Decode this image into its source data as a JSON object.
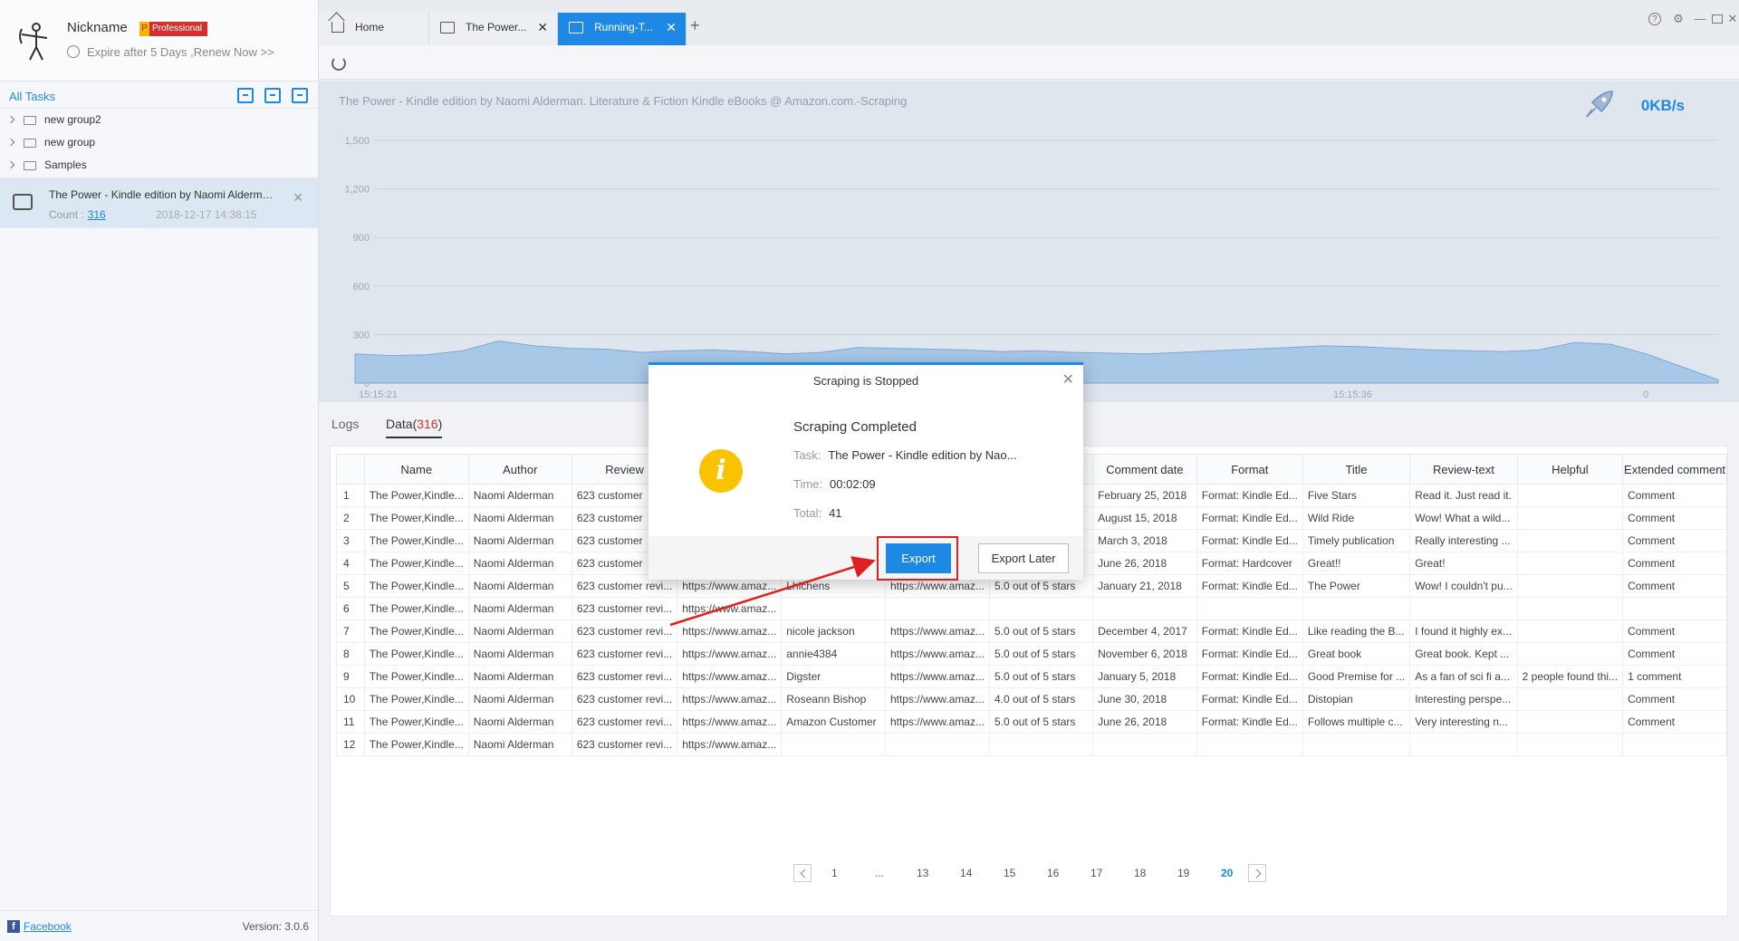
{
  "profile": {
    "nickname": "Nickname",
    "badge": "Professional",
    "expire": "Expire after 5 Days ,Renew Now >>"
  },
  "sidebar": {
    "all_tasks": "All Tasks",
    "groups": [
      "new group2",
      "new group",
      "Samples"
    ],
    "task": {
      "title": "The Power - Kindle edition by Naomi Alderman. Literature & Fiction Kindle eBooks @ Amazon.com.-Scraping",
      "count_label": "Count :",
      "count": "316",
      "date": "2018-12-17 14:38:15"
    },
    "footer": {
      "facebook": "Facebook",
      "version": "Version: 3.0.6"
    }
  },
  "tabs": [
    {
      "label": "Home"
    },
    {
      "label": "The Power..."
    },
    {
      "label": "Running-T..."
    }
  ],
  "chart": {
    "title": "The Power - Kindle edition by Naomi Alderman. Literature & Fiction Kindle eBooks @ Amazon.com.-Scraping",
    "speed": "0KB/s"
  },
  "chart_data": {
    "type": "area",
    "y_ticks": [
      "1,500",
      "1,200",
      "900",
      "600",
      "300",
      "0"
    ],
    "x_ticks": [
      "15:15:21",
      "15:15:36",
      "0"
    ],
    "ylim": [
      0,
      1500
    ],
    "values": [
      180,
      170,
      175,
      200,
      260,
      230,
      215,
      210,
      190,
      200,
      205,
      195,
      180,
      190,
      220,
      215,
      210,
      205,
      195,
      200,
      190,
      185,
      180,
      190,
      200,
      210,
      220,
      230,
      225,
      215,
      205,
      200,
      195,
      205,
      250,
      240,
      180,
      100,
      20
    ],
    "color": "#a8c8e8"
  },
  "data_tabs": {
    "logs": "Logs",
    "data": "Data(",
    "data_count": "316",
    "data_close": ")"
  },
  "table": {
    "columns": [
      "",
      "Name",
      "Author",
      "Review",
      "",
      "",
      "",
      "",
      "Comment date",
      "Format",
      "Title",
      "Review-text",
      "Helpful",
      "Extended comment"
    ],
    "rows": [
      [
        "1",
        "The Power,Kindle...",
        "Naomi Alderman",
        "623 customer",
        "",
        "",
        "",
        "",
        "February 25, 2018",
        "Format: Kindle Ed...",
        "Five Stars",
        "Read it. Just read it.",
        "",
        "Comment"
      ],
      [
        "2",
        "The Power,Kindle...",
        "Naomi Alderman",
        "623 customer",
        "",
        "",
        "",
        "",
        "August 15, 2018",
        "Format: Kindle Ed...",
        "Wild Ride",
        "Wow! What a wild...",
        "",
        "Comment"
      ],
      [
        "3",
        "The Power,Kindle...",
        "Naomi Alderman",
        "623 customer",
        "",
        "",
        "",
        "",
        "March 3, 2018",
        "Format: Kindle Ed...",
        "Timely publication",
        "Really interesting ...",
        "",
        "Comment"
      ],
      [
        "4",
        "The Power,Kindle...",
        "Naomi Alderman",
        "623 customer",
        "",
        "",
        "",
        "",
        "June 26, 2018",
        "Format: Hardcover",
        "Great!!",
        "Great!",
        "",
        "Comment"
      ],
      [
        "5",
        "The Power,Kindle...",
        "Naomi Alderman",
        "623 customer revi...",
        "https://www.amaz...",
        "Lhichens",
        "https://www.amaz...",
        "5.0 out of 5 stars",
        "January 21, 2018",
        "Format: Kindle Ed...",
        "The Power",
        "Wow! I couldn't pu...",
        "",
        "Comment"
      ],
      [
        "6",
        "The Power,Kindle...",
        "Naomi Alderman",
        "623 customer revi...",
        "https://www.amaz...",
        "",
        "",
        "",
        "",
        "",
        "",
        "",
        "",
        ""
      ],
      [
        "7",
        "The Power,Kindle...",
        "Naomi Alderman",
        "623 customer revi...",
        "https://www.amaz...",
        "nicole jackson",
        "https://www.amaz...",
        "5.0 out of 5 stars",
        "December 4, 2017",
        "Format: Kindle Ed...",
        "Like reading the B...",
        "I found it highly ex...",
        "",
        "Comment"
      ],
      [
        "8",
        "The Power,Kindle...",
        "Naomi Alderman",
        "623 customer revi...",
        "https://www.amaz...",
        "annie4384",
        "https://www.amaz...",
        "5.0 out of 5 stars",
        "November 6, 2018",
        "Format: Kindle Ed...",
        "Great book",
        "Great book. Kept ...",
        "",
        "Comment"
      ],
      [
        "9",
        "The Power,Kindle...",
        "Naomi Alderman",
        "623 customer revi...",
        "https://www.amaz...",
        "Digster",
        "https://www.amaz...",
        "5.0 out of 5 stars",
        "January 5, 2018",
        "Format: Kindle Ed...",
        "Good Premise for ...",
        "As a fan of sci fi a...",
        "2 people found thi...",
        "1 comment"
      ],
      [
        "10",
        "The Power,Kindle...",
        "Naomi Alderman",
        "623 customer revi...",
        "https://www.amaz...",
        "Roseann Bishop",
        "https://www.amaz...",
        "4.0 out of 5 stars",
        "June 30, 2018",
        "Format: Kindle Ed...",
        "Distopian",
        "Interesting perspe...",
        "",
        "Comment"
      ],
      [
        "11",
        "The Power,Kindle...",
        "Naomi Alderman",
        "623 customer revi...",
        "https://www.amaz...",
        "Amazon Customer",
        "https://www.amaz...",
        "5.0 out of 5 stars",
        "June 26, 2018",
        "Format: Kindle Ed...",
        "Follows multiple c...",
        "Very interesting n...",
        "",
        "Comment"
      ],
      [
        "12",
        "The Power,Kindle...",
        "Naomi Alderman",
        "623 customer revi...",
        "https://www.amaz...",
        "",
        "",
        "",
        "",
        "",
        "",
        "",
        "",
        ""
      ]
    ]
  },
  "pager": {
    "pages": [
      "1",
      "...",
      "13",
      "14",
      "15",
      "16",
      "17",
      "18",
      "19",
      "20"
    ],
    "active": "20"
  },
  "dialog": {
    "title": "Scraping is Stopped",
    "heading": "Scraping Completed",
    "task_label": "Task:",
    "task_value": "The Power - Kindle edition by Nao...",
    "time_label": "Time:",
    "time_value": "00:02:09",
    "total_label": "Total:",
    "total_value": "41",
    "export": "Export",
    "export_later": "Export Later"
  },
  "colors": {
    "accent": "#1e88e5",
    "highlight": "#e02020",
    "info": "#f9c300",
    "badge": "#d32f2f"
  }
}
